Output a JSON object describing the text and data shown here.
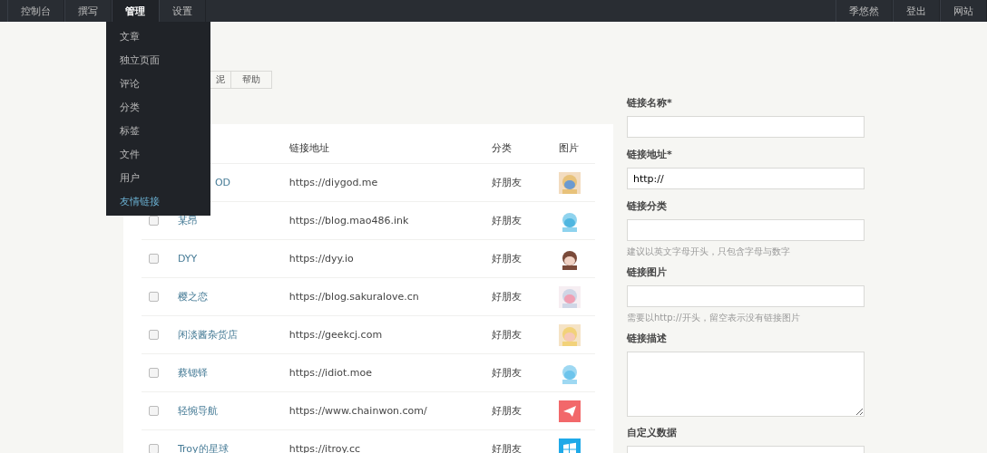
{
  "nav": {
    "left": [
      {
        "label": "控制台",
        "selected": false
      },
      {
        "label": "撰写",
        "selected": false
      },
      {
        "label": "管理",
        "selected": true
      },
      {
        "label": "设置",
        "selected": false
      }
    ],
    "right": [
      {
        "label": "季悠然"
      },
      {
        "label": "登出"
      },
      {
        "label": "网站"
      }
    ]
  },
  "menu": [
    {
      "label": "文章",
      "selected": false
    },
    {
      "label": "独立页面",
      "selected": false
    },
    {
      "label": "评论",
      "selected": false
    },
    {
      "label": "分类",
      "selected": false
    },
    {
      "label": "标签",
      "selected": false
    },
    {
      "label": "文件",
      "selected": false
    },
    {
      "label": "用户",
      "selected": false
    },
    {
      "label": "友情链接",
      "selected": true
    }
  ],
  "tabs": [
    {
      "label": "泥"
    },
    {
      "label": "帮助"
    }
  ],
  "table": {
    "columns": [
      "链接地址",
      "分类",
      "图片"
    ],
    "rows": [
      {
        "name": "OD",
        "url": "https://diygod.me",
        "category": "好朋友"
      },
      {
        "checked": false,
        "name": "某昂",
        "url": "https://blog.mao486.ink",
        "category": "好朋友"
      },
      {
        "checked": false,
        "name": "DYY",
        "url": "https://dyy.io",
        "category": "好朋友"
      },
      {
        "checked": false,
        "name": "樱之恋",
        "url": "https://blog.sakuralove.cn",
        "category": "好朋友"
      },
      {
        "checked": false,
        "name": "闲淡酱杂货店",
        "url": "https://geekcj.com",
        "category": "好朋友"
      },
      {
        "checked": false,
        "name": "蔡锶铎",
        "url": "https://idiot.moe",
        "category": "好朋友"
      },
      {
        "checked": false,
        "name": "轻惋导航",
        "url": "https://www.chainwon.com/",
        "category": "好朋友",
        "image": {
          "kind": "plane"
        }
      },
      {
        "checked": false,
        "name": "Troy的星球",
        "url": "https://itroy.cc",
        "category": "好朋友",
        "image": {
          "kind": "windows"
        }
      }
    ]
  },
  "form": [
    {
      "label": "链接名称*",
      "kind": "input"
    },
    {
      "label": "链接地址*",
      "kind": "input",
      "value": "http://"
    },
    {
      "label": "链接分类",
      "kind": "input",
      "hint": "建议以英文字母开头，只包含字母与数字"
    },
    {
      "label": "链接图片",
      "kind": "input",
      "hint": "需要以http://开头，留空表示没有链接图片"
    },
    {
      "label": "链接描述",
      "kind": "textarea"
    },
    {
      "label": "自定义数据",
      "kind": "input"
    }
  ]
}
